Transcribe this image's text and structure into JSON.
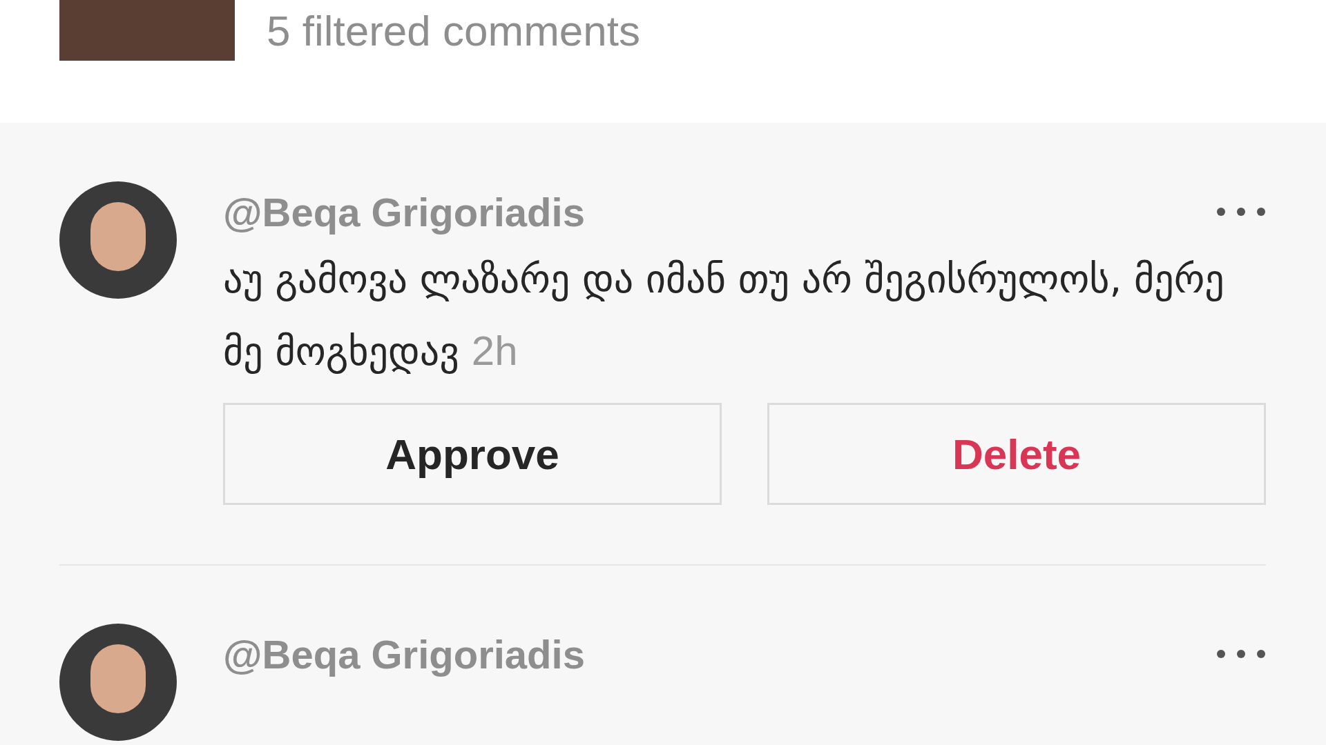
{
  "header": {
    "filtered_count": "5 filtered comments"
  },
  "comments": [
    {
      "username": "@Beqa Grigoriadis",
      "text": "აუ გამოვა ლაზარე და იმან თუ არ შეგისრულოს, მერე მე მოგხედავ",
      "time": "2h",
      "actions": [
        {
          "label": "Approve",
          "kind": "approve"
        },
        {
          "label": "Delete",
          "kind": "delete"
        }
      ]
    },
    {
      "username": "@Beqa Grigoriadis"
    }
  ]
}
